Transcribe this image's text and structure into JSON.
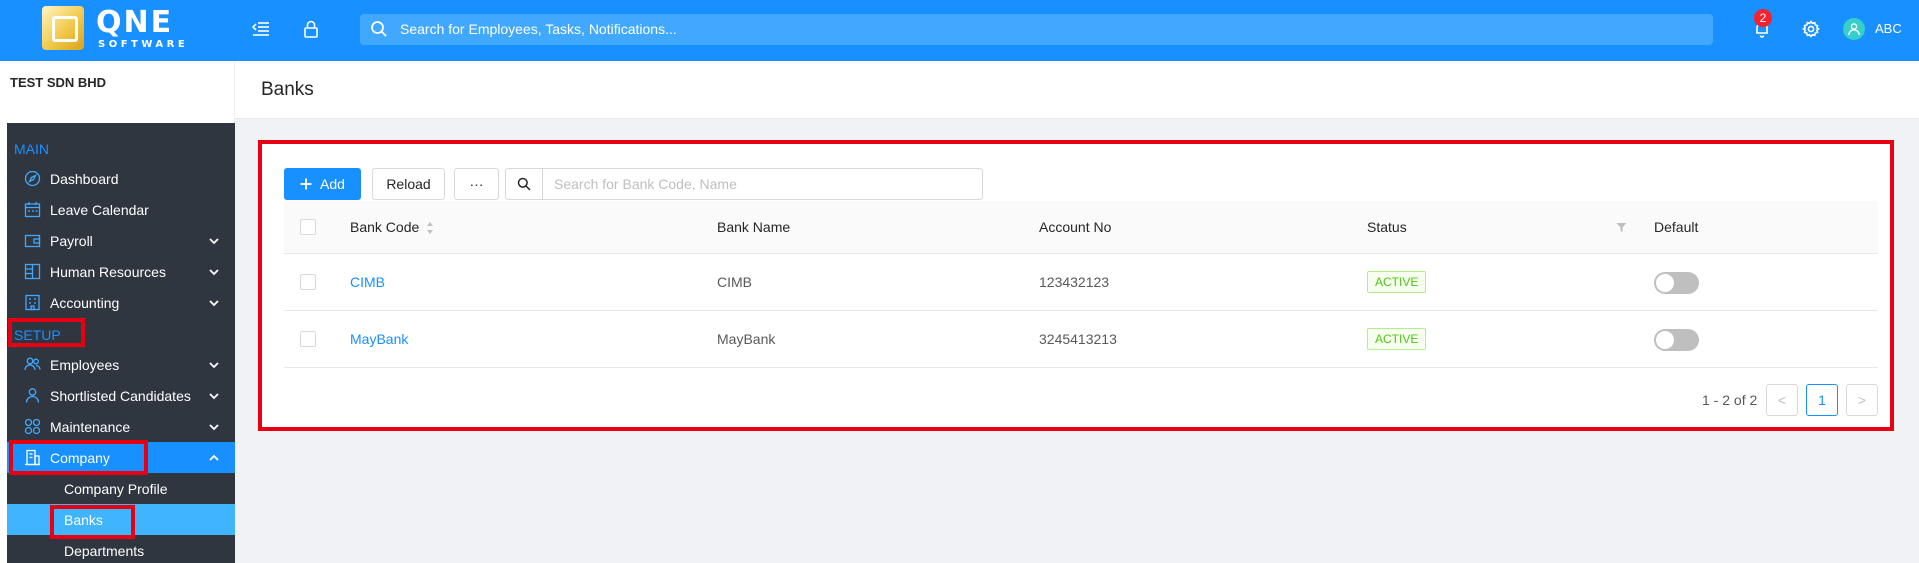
{
  "app": {
    "logo_text": "QNE",
    "logo_sub": "SOFTWARE",
    "search_placeholder": "Search for Employees, Tasks, Notifications...",
    "notification_count": "2",
    "user_name": "ABC"
  },
  "sidebar": {
    "company": "TEST SDN BHD",
    "sections": {
      "main": "MAIN",
      "setup": "SETUP"
    },
    "items": [
      {
        "label": "Dashboard",
        "icon": "compass-icon"
      },
      {
        "label": "Leave Calendar",
        "icon": "calendar-icon"
      },
      {
        "label": "Payroll",
        "icon": "wallet-icon"
      },
      {
        "label": "Human Resources",
        "icon": "people-icon"
      },
      {
        "label": "Accounting",
        "icon": "building-icon"
      },
      {
        "label": "Employees",
        "icon": "team-icon"
      },
      {
        "label": "Shortlisted Candidates",
        "icon": "user-icon"
      },
      {
        "label": "Maintenance",
        "icon": "tools-icon"
      },
      {
        "label": "Company",
        "icon": "company-icon"
      }
    ],
    "subitems": [
      "Company Profile",
      "Banks",
      "Departments"
    ]
  },
  "page": {
    "title": "Banks",
    "toolbar": {
      "add": "Add",
      "reload": "Reload",
      "more": "···",
      "search_placeholder": "Search for Bank Code, Name"
    },
    "columns": [
      "Bank Code",
      "Bank Name",
      "Account No",
      "Status",
      "Default"
    ],
    "rows": [
      {
        "code": "CIMB",
        "name": "CIMB",
        "account": "123432123",
        "status": "ACTIVE",
        "default": false
      },
      {
        "code": "MayBank",
        "name": "MayBank",
        "account": "3245413213",
        "status": "ACTIVE",
        "default": false
      }
    ],
    "pagination": {
      "total": "1 - 2 of 2",
      "current": "1",
      "prev": "<",
      "next": ">"
    }
  },
  "colors": {
    "primary": "#1890ff",
    "sidebar": "#2f3640",
    "highlight": "#e60012",
    "active_tag": "#52c41a"
  }
}
